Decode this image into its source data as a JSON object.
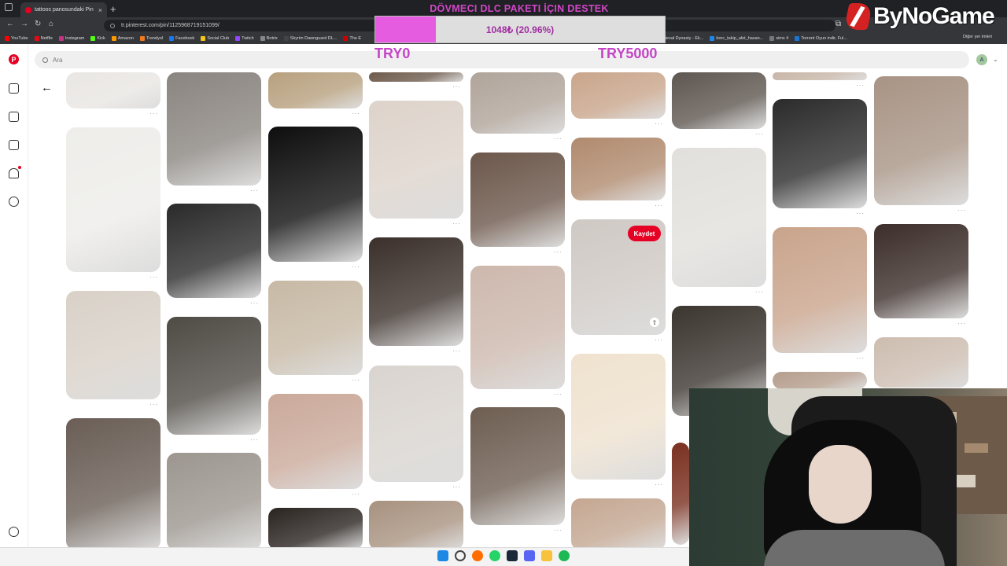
{
  "browser": {
    "tab_title": "tattoos panosundaki Pin",
    "url": "tr.pinterest.com/pin/1125968719151099/",
    "bookmarks": [
      {
        "label": "YouTube",
        "color": "#ff0000"
      },
      {
        "label": "Netflix",
        "color": "#e50914"
      },
      {
        "label": "Instagram",
        "color": "#c13584"
      },
      {
        "label": "Kick",
        "color": "#53fc18"
      },
      {
        "label": "Amazon",
        "color": "#ff9900"
      },
      {
        "label": "Trendyol",
        "color": "#f27a1a"
      },
      {
        "label": "Facebook",
        "color": "#1877f2"
      },
      {
        "label": "Social Club",
        "color": "#f5c518"
      },
      {
        "label": "Twitch",
        "color": "#9146ff"
      },
      {
        "label": "Botrix",
        "color": "#888888"
      },
      {
        "label": "Skyrim Dawnguard DL...",
        "color": "#444444"
      },
      {
        "label": "The E",
        "color": "#cc0000"
      },
      {
        "label": "Medieval Dynasty - Ek...",
        "color": "#2e7d32"
      },
      {
        "label": "borc_takip_alet_hasan...",
        "color": "#1e88e5"
      },
      {
        "label": "sims 4",
        "color": "#777777"
      },
      {
        "label": "Torrent Oyun indir, Ful...",
        "color": "#1976d2"
      }
    ],
    "other_bookmarks": "Diğer yer imleri"
  },
  "donation": {
    "title": "DÖVMECI DLC PAKETI İÇIN DESTEK",
    "progress_text": "1048₺ (20.96%)",
    "progress_fraction": 0.2096,
    "min_label": "TRY0",
    "max_label": "TRY5000"
  },
  "logo_text": "ByNoGame",
  "pinterest": {
    "search_placeholder": "Ara",
    "avatar_letter": "A",
    "save_label": "Kaydet",
    "nav_icons": [
      "home-icon",
      "explore-icon",
      "create-icon",
      "notifications-icon",
      "messages-icon",
      "settings-icon"
    ],
    "accent": "#e60023"
  }
}
